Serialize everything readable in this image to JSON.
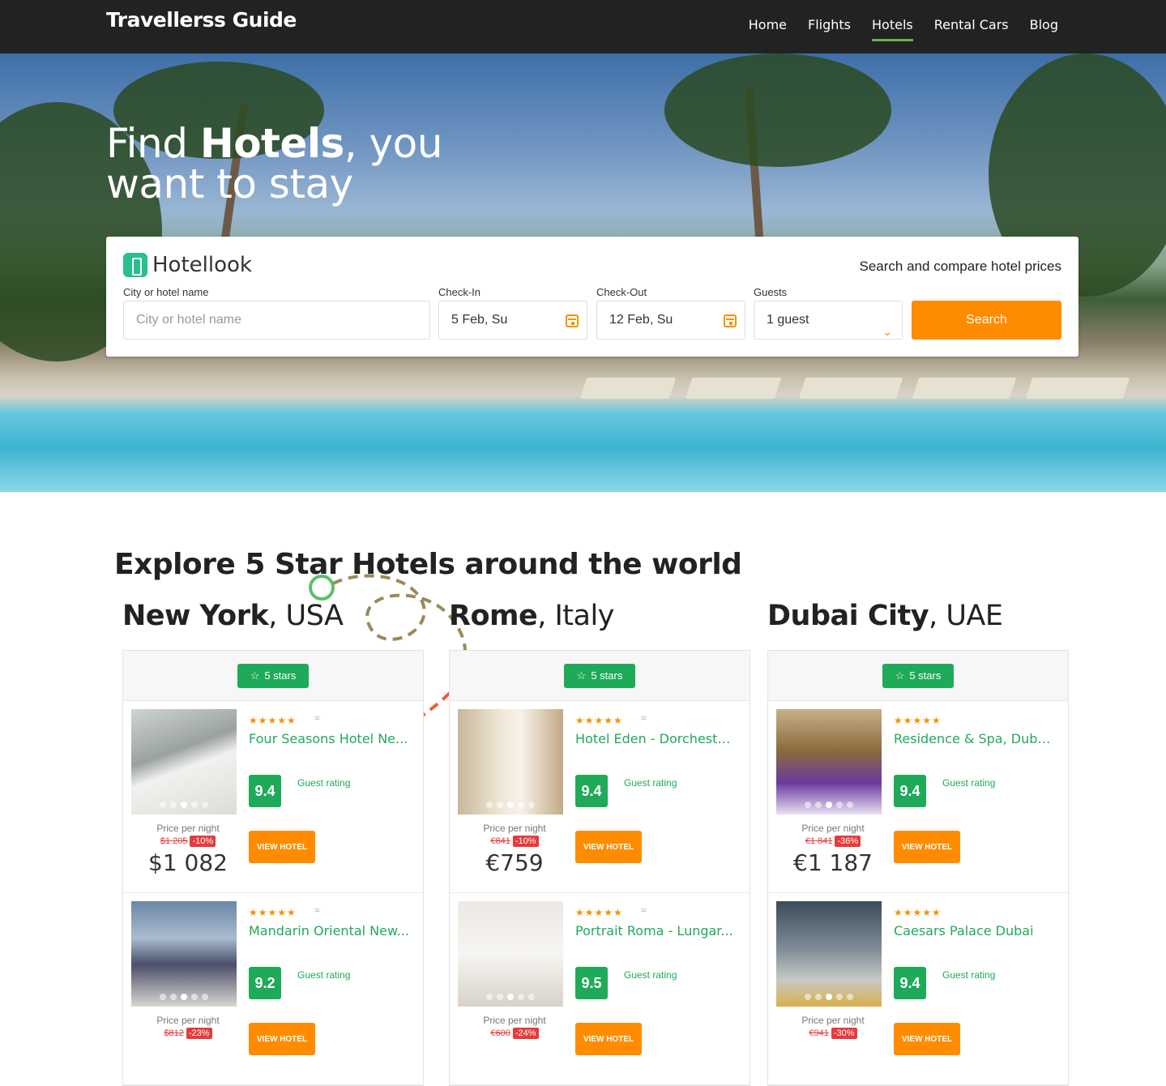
{
  "header": {
    "brand": "Travellerss Guide",
    "nav": [
      {
        "label": "Home"
      },
      {
        "label": "Flights"
      },
      {
        "label": "Hotels",
        "active": true
      },
      {
        "label": "Rental Cars"
      },
      {
        "label": "Blog"
      }
    ]
  },
  "hero": {
    "title_pre": "Find ",
    "title_bold": "Hotels",
    "title_post": ", you",
    "title_line2": "want to stay"
  },
  "search": {
    "logo_text": "Hotellook",
    "compare_text": "Search and compare hotel prices",
    "city_label": "City or hotel name",
    "city_placeholder": "City or hotel name",
    "checkin_label": "Check-In",
    "checkin_value": "5 Feb, Su",
    "checkout_label": "Check-Out",
    "checkout_value": "12 Feb, Su",
    "guests_label": "Guests",
    "guests_value": "1 guest",
    "search_button": "Search"
  },
  "explore": {
    "pre": "Explore ",
    "bold": "5 Star Hotels",
    "post": " around the world"
  },
  "colors": {
    "brand_green": "#1faa59",
    "accent_orange": "#ff8c00",
    "discount_red": "#e63b3b",
    "topbar": "#222222"
  },
  "columns": [
    {
      "city": "New York",
      "country": ", USA",
      "badge": "5 stars",
      "hotels": [
        {
          "stars": "★★★★★",
          "name": "Four Seasons Hotel Ne...",
          "score": "9.4",
          "rating_label": "Guest rating",
          "ppn": "Price per night",
          "old_price": "$1 205",
          "discount": "-10%",
          "price": "$1 082",
          "button": "VIEW HOTEL"
        },
        {
          "stars": "★★★★★",
          "name": "Mandarin Oriental New...",
          "score": "9.2",
          "rating_label": "Guest rating",
          "ppn": "Price per night",
          "old_price": "$812",
          "discount": "-23%",
          "price": "",
          "button": "VIEW HOTEL"
        }
      ]
    },
    {
      "city": "Rome",
      "country": ", Italy",
      "badge": "5 stars",
      "hotels": [
        {
          "stars": "★★★★★",
          "name": "Hotel Eden - Dorchester...",
          "score": "9.4",
          "rating_label": "Guest rating",
          "ppn": "Price per night",
          "old_price": "€841",
          "discount": "-10%",
          "price": "€759",
          "button": "VIEW HOTEL"
        },
        {
          "stars": "★★★★★",
          "name": "Portrait Roma - Lungar...",
          "score": "9.5",
          "rating_label": "Guest rating",
          "ppn": "Price per night",
          "old_price": "€600",
          "discount": "-24%",
          "price": "",
          "button": "VIEW HOTEL"
        }
      ]
    },
    {
      "city": "Dubai City",
      "country": ", UAE",
      "badge": "5 stars",
      "hotels": [
        {
          "stars": "★★★★★",
          "name": "Residence & Spa, Dubai...",
          "score": "9.4",
          "rating_label": "Guest rating",
          "ppn": "Price per night",
          "old_price": "€1 841",
          "discount": "-36%",
          "price": "€1 187",
          "button": "VIEW HOTEL"
        },
        {
          "stars": "★★★★★",
          "name": "Caesars Palace Dubai",
          "score": "9.4",
          "rating_label": "Guest rating",
          "ppn": "Price per night",
          "old_price": "€941",
          "discount": "-30%",
          "price": "",
          "button": "VIEW HOTEL"
        }
      ]
    }
  ]
}
